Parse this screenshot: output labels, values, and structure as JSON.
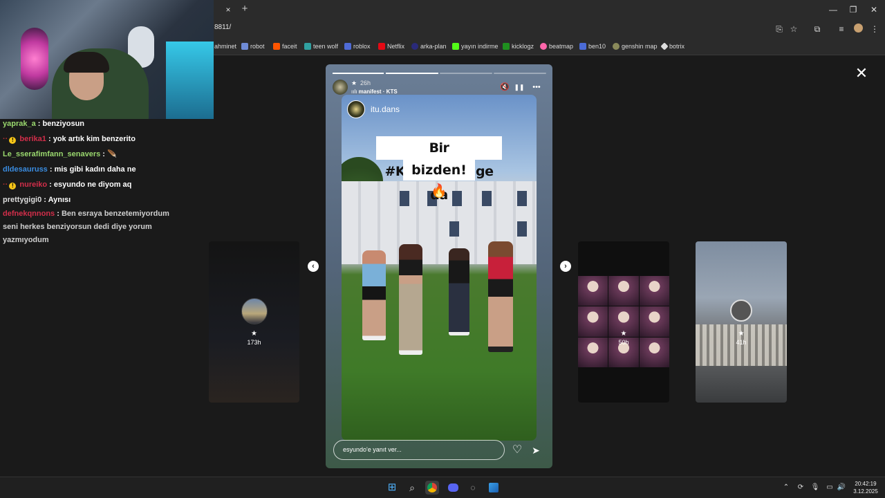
{
  "browser": {
    "url": "8811/",
    "tab_close": "×",
    "new_tab": "+",
    "window_controls": {
      "minimize": "—",
      "restore": "❐",
      "close": "✕"
    },
    "bookmarks": [
      {
        "label": "ahminet",
        "color": "#2b2b2b"
      },
      {
        "label": "robot",
        "color": "#6f8bd6"
      },
      {
        "label": "faceit",
        "color": "#ff5500"
      },
      {
        "label": "teen wolf",
        "color": "#30a0a0"
      },
      {
        "label": "roblox",
        "color": "#4f6bd6"
      },
      {
        "label": "Netflix",
        "color": "#e50914"
      },
      {
        "label": "arka-plan",
        "color": "#2a2a7a"
      },
      {
        "label": "yayın indirme",
        "color": "#53fc18"
      },
      {
        "label": "kicklogz",
        "color": "#1f8f1f"
      },
      {
        "label": "beatmap",
        "color": "#ff66aa"
      },
      {
        "label": "ben10",
        "color": "#4b6bd6"
      },
      {
        "label": "genshin map",
        "color": "#8a8a5a"
      },
      {
        "label": "botrix",
        "color": "#dddddd"
      }
    ]
  },
  "chat": [
    {
      "user": "yaprak_a",
      "color": "#9ad86e",
      "text": "benziyosun",
      "badge": false,
      "prefix": ""
    },
    {
      "user": "berika1",
      "color": "#d22e4a",
      "text": "yok artık kim benzerito",
      "badge": true,
      "prefix": ""
    },
    {
      "user": "Le_sserafimfann_senavers",
      "color": "#9ad86e",
      "text": "🪶",
      "badge": false,
      "prefix": ""
    },
    {
      "user": "dldesauruss",
      "color": "#3a8ce0",
      "text": "mis gibi kadın daha ne",
      "badge": false,
      "prefix": ""
    },
    {
      "user": "nureiko",
      "color": "#d22e4a",
      "text": "esyundo ne diyom aq",
      "badge": true,
      "prefix": ""
    },
    {
      "user": "prettygigi0",
      "color": "#dddddd",
      "text": "Aynısı",
      "badge": false,
      "prefix": ""
    },
    {
      "user": "defnekqnnons",
      "color": "#d22e4a",
      "text": "Ben esraya benzetemiyordum",
      "badge": false,
      "prefix": ""
    }
  ],
  "chat_continuation": [
    "seni herkes benziyorsun dedi diye yorum",
    "yazmıyodum"
  ],
  "story": {
    "progress": [
      1,
      1,
      0,
      0
    ],
    "time": "26h",
    "music": "manifest · KTS",
    "repost_user": "itu.dans",
    "sticker_line1": "Bir #KTSChallenge da",
    "sticker_line2": "bizden! 🔥",
    "reply_placeholder": "esyundo'e yanıt ver...",
    "icons": {
      "mute": "🔇",
      "pause": "❚❚",
      "more": "•••",
      "heart": "♡",
      "send": "➤",
      "star": "★"
    }
  },
  "side_stories": {
    "left": {
      "age": "173h"
    },
    "right1": {
      "age": "50h"
    },
    "right2": {
      "age": "41h"
    }
  },
  "nav": {
    "prev": "‹",
    "next": "›",
    "close": "✕"
  },
  "taskbar": {
    "time": "20:42:19",
    "date": "3.12.2025"
  }
}
